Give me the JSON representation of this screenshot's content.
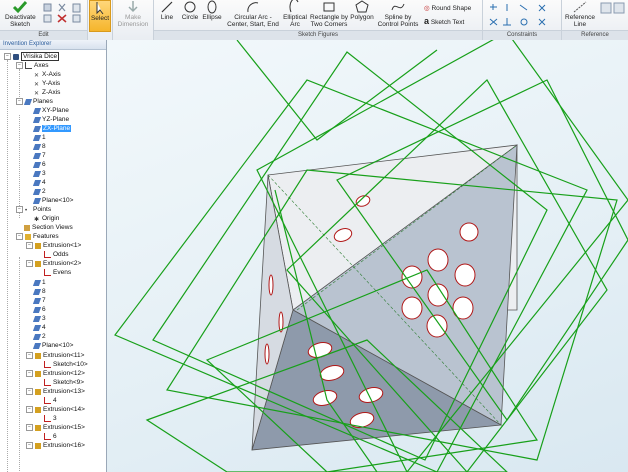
{
  "ribbon": {
    "deactivate_label": "Deactivate Sketch",
    "edit_group_label": "Edit",
    "select_label": "Select",
    "make_dimension_label": "Make Dimension",
    "tools": {
      "line": "Line",
      "circle": "Circle",
      "ellipse": "Ellipse",
      "circular_arc": "Circular Arc -",
      "circular_arc_sub": "Center, Start, End",
      "elliptical_arc": "Elliptical",
      "elliptical_arc_sub": "Arc",
      "rectangle": "Rectangle by",
      "rectangle_sub": "Two Corners",
      "polygon": "Polygon",
      "spline": "Spline by",
      "spline_sub": "Control Points",
      "round_shape": "Round Shape",
      "sketch_text": "Sketch Text",
      "reference_line": "Reference",
      "reference_line_sub": "Line"
    },
    "sketch_figures_label": "Sketch Figures",
    "constraints_label": "Constraints",
    "reference_label": "Reference"
  },
  "tree": {
    "title": "Invention Explorer",
    "root": "Vrisika Dice",
    "axes": "Axes",
    "x_axis": "X-Axis",
    "y_axis": "Y-Axis",
    "z_axis": "Z-Axis",
    "planes": "Planes",
    "xy_plane": "XY-Plane",
    "yz_plane": "YZ-Plane",
    "zx_plane": "ZX-Plane",
    "plane_items": [
      "1",
      "8",
      "7",
      "6",
      "3",
      "4",
      "2"
    ],
    "plane10": "Plane<10>",
    "points": "Points",
    "origin": "Origin",
    "section_views": "Section Views",
    "features": "Features",
    "extrusion1": "Extrusion<1>",
    "odds": "Odds",
    "extrusion2": "Extrusion<2>",
    "evens": "Evens",
    "feature_items": [
      "1",
      "8",
      "7",
      "6",
      "3",
      "4",
      "2"
    ],
    "plane10b": "Plane<10>",
    "extrusion11": "Extrusion<11>",
    "sketch10": "Sketch<10>",
    "extrusion12": "Extrusion<12>",
    "sketch9": "Sketch<9>",
    "extrusion13": "Extrusion<13>",
    "s4": "4",
    "extrusion14": "Extrusion<14>",
    "s3": "3",
    "extrusion15": "Extrusion<15>",
    "s6": "6",
    "extrusion16": "Extrusion<16>"
  },
  "colors": {
    "select_highlight": "#f5b52c",
    "tree_selection": "#3399ff",
    "sketch_lines": "#18a01a",
    "face_dark": "#8a96a8",
    "face_light": "#eceef1",
    "hole_rim": "#b01818"
  }
}
